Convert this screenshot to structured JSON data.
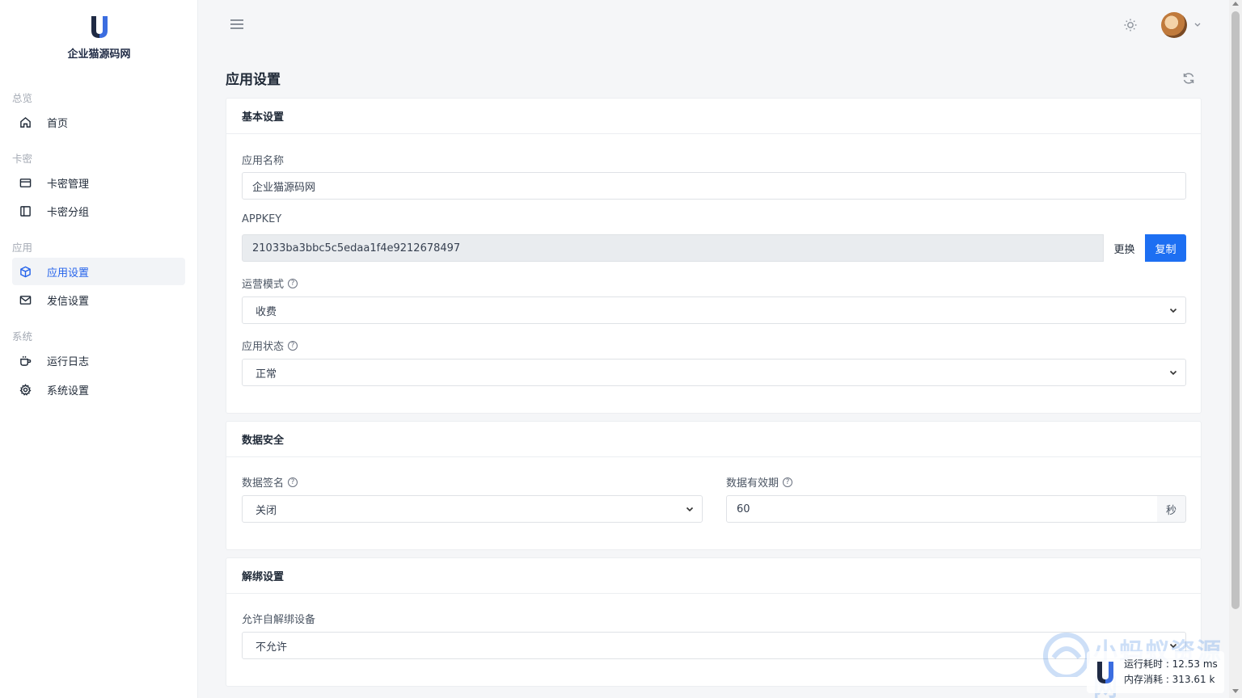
{
  "brand": {
    "name": "企业猫源码网"
  },
  "sidebar": {
    "sections": [
      {
        "title": "总览",
        "items": [
          {
            "label": "首页",
            "icon": "home-icon"
          }
        ]
      },
      {
        "title": "卡密",
        "items": [
          {
            "label": "卡密管理",
            "icon": "card-icon"
          },
          {
            "label": "卡密分组",
            "icon": "panel-icon"
          }
        ]
      },
      {
        "title": "应用",
        "items": [
          {
            "label": "应用设置",
            "icon": "cube-icon",
            "active": true
          },
          {
            "label": "发信设置",
            "icon": "mail-icon"
          }
        ]
      },
      {
        "title": "系统",
        "items": [
          {
            "label": "运行日志",
            "icon": "coffee-icon"
          },
          {
            "label": "系统设置",
            "icon": "gear-icon"
          }
        ]
      }
    ]
  },
  "page": {
    "title": "应用设置"
  },
  "basic": {
    "title": "基本设置",
    "app_name_label": "应用名称",
    "app_name_value": "企业猫源码网",
    "appkey_label": "APPKEY",
    "appkey_value": "21033ba3bbc5c5edaa1f4e9212678497",
    "change_label": "更换",
    "copy_label": "复制",
    "mode_label": "运营模式",
    "mode_value": "收费",
    "status_label": "应用状态",
    "status_value": "正常"
  },
  "security": {
    "title": "数据安全",
    "sign_label": "数据签名",
    "sign_value": "关闭",
    "validity_label": "数据有效期",
    "validity_value": "60",
    "validity_unit": "秒"
  },
  "unbind": {
    "title": "解绑设置",
    "allow_label": "允许自解绑设备",
    "allow_value": "不允许"
  },
  "perf": {
    "runtime": "运行耗时 : 12.53 ms",
    "memory": "内存消耗 : 313.61 k"
  },
  "watermark": "小蚂蚁资源网",
  "colors": {
    "primary": "#1d6ff2",
    "active_text": "#2563eb",
    "brand_dark": "#1f2a44"
  }
}
